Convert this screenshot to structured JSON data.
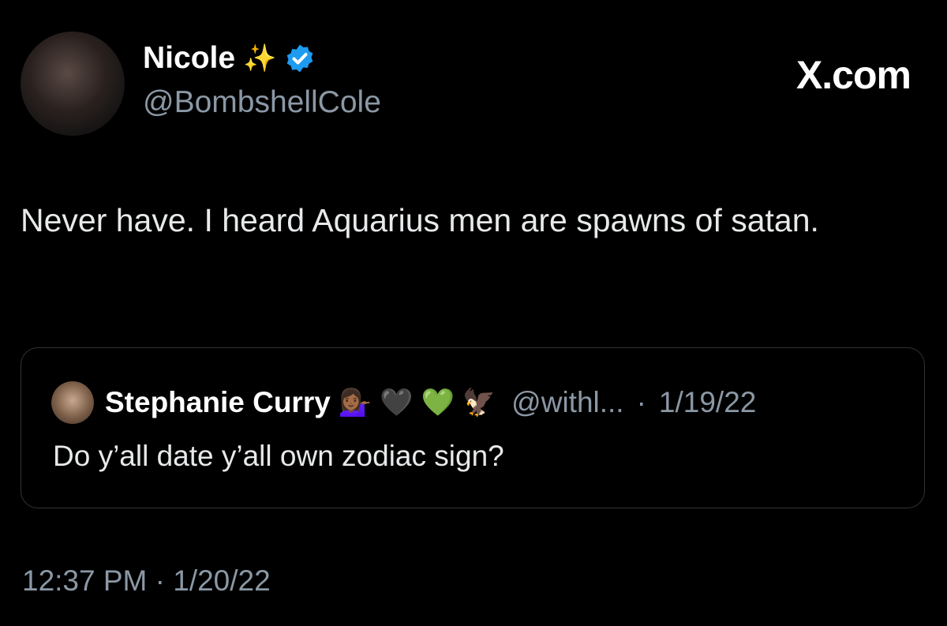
{
  "author": {
    "name": "Nicole",
    "name_emoji": "✨",
    "handle": "@BombshellCole",
    "verified_color": "#1d9bf0"
  },
  "site_logo": "X.com",
  "tweet": {
    "text": "Never have. I heard Aquarius men are spawns of satan.",
    "timestamp": "12:37 PM · 1/20/22"
  },
  "quoted": {
    "name": "Stephanie Curry",
    "emojis": [
      "💁🏾‍♀️",
      "🖤",
      "💚",
      "🦅"
    ],
    "handle": "@withl...",
    "date": "1/19/22",
    "separator": "·",
    "text": "Do y’all date y’all own zodiac sign?"
  }
}
